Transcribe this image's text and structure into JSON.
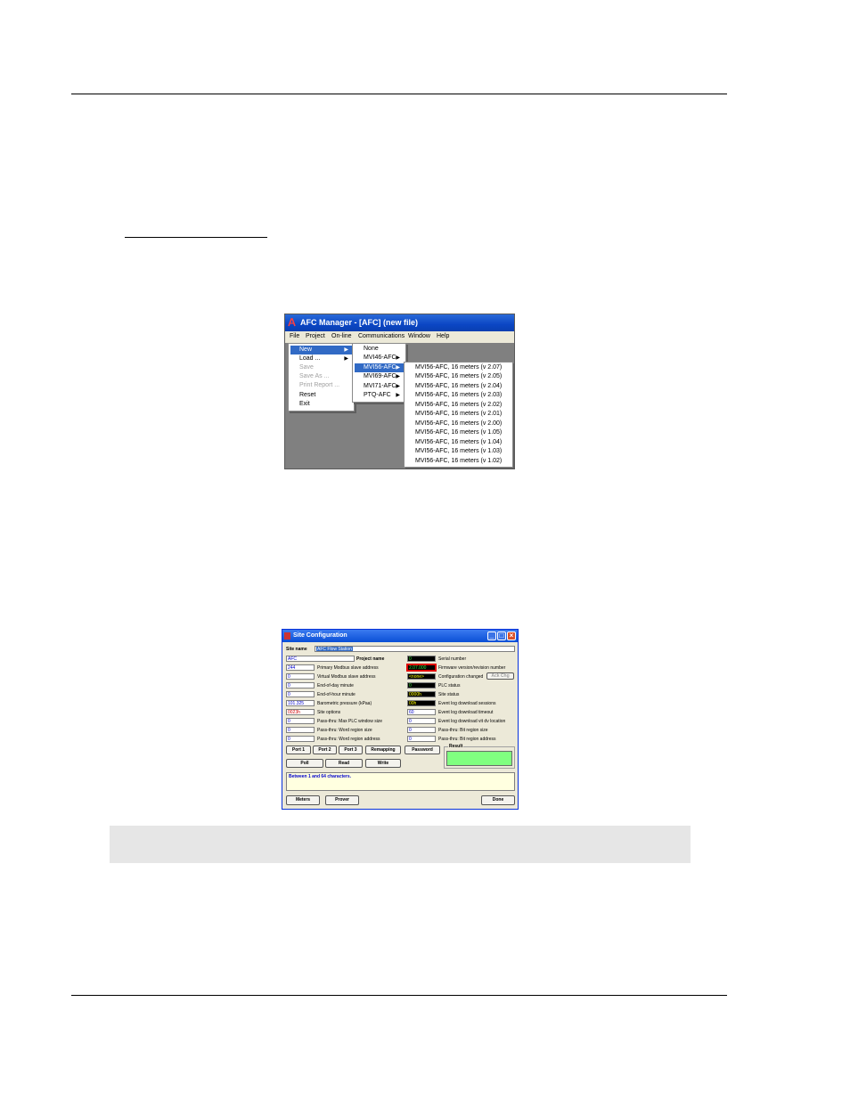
{
  "afc_manager": {
    "title": "AFC Manager  - [AFC] (new file)",
    "menu": [
      "File",
      "Project",
      "On-line",
      "Communications",
      "Window",
      "Help"
    ],
    "file_menu": [
      {
        "label": "New",
        "state": "selected",
        "submenu": true
      },
      {
        "label": "Load ...",
        "state": "normal",
        "submenu": true
      },
      {
        "label": "Save",
        "state": "disabled"
      },
      {
        "label": "Save As ...",
        "state": "disabled"
      },
      {
        "label": "Print Report ...",
        "state": "disabled"
      },
      {
        "label": "Reset",
        "state": "normal"
      },
      {
        "label": "Exit",
        "state": "normal"
      }
    ],
    "new_menu": [
      {
        "label": "None",
        "state": "normal",
        "submenu": false
      },
      {
        "label": "MVI46-AFC",
        "state": "normal",
        "submenu": true
      },
      {
        "label": "MVI56-AFC",
        "state": "selected",
        "submenu": true
      },
      {
        "label": "MVI69-AFC",
        "state": "normal",
        "submenu": true
      },
      {
        "label": "MVI71-AFC",
        "state": "normal",
        "submenu": true
      },
      {
        "label": "PTQ-AFC",
        "state": "normal",
        "submenu": true
      }
    ],
    "mvi56_menu": [
      "MVI56-AFC, 16 meters (v 2.07)",
      "MVI56-AFC, 16 meters (v 2.05)",
      "MVI56-AFC, 16 meters (v 2.04)",
      "MVI56-AFC, 16 meters (v 2.03)",
      "MVI56-AFC, 16 meters (v 2.02)",
      "MVI56-AFC, 16 meters (v 2.01)",
      "MVI56-AFC, 16 meters (v 2.00)",
      "MVI56-AFC, 16 meters (v 1.05)",
      "MVI56-AFC, 16 meters (v 1.04)",
      "MVI56-AFC, 16 meters (v 1.03)",
      "MVI56-AFC, 16 meters (v 1.02)"
    ]
  },
  "site_config": {
    "title": "Site Configuration",
    "site_name_label": "Site name",
    "site_name_value": "AFC Flow Station",
    "project_name_label": "Project name",
    "left_rows": [
      {
        "value": "AFC",
        "label": ""
      },
      {
        "value": "244",
        "label": "Primary Modbus slave address"
      },
      {
        "value": "0",
        "label": "Virtual Modbus slave address"
      },
      {
        "value": "0",
        "label": "End-of-day minute"
      },
      {
        "value": "0",
        "label": "End-of-hour minute"
      },
      {
        "value": "101.325",
        "label": "Barometric pressure (kPaa)"
      },
      {
        "value": "0023h",
        "label": "Site options"
      },
      {
        "value": "0",
        "label": "Pass-thru: Max PLC window size"
      },
      {
        "value": "0",
        "label": "Pass-thru: Word region size"
      },
      {
        "value": "0",
        "label": "Pass-thru: Word region address"
      }
    ],
    "right_rows": [
      {
        "value": "0",
        "label": "Serial number"
      },
      {
        "value": "2.07.000",
        "label": "Firmware version/revision number"
      },
      {
        "value": "<none>",
        "label": "Configuration changed"
      },
      {
        "value": "0",
        "label": "PLC status"
      },
      {
        "value": "0000h",
        "label": "Site status"
      },
      {
        "value": "00h",
        "label": "Event log download sessions"
      },
      {
        "value": "60",
        "label": "Event log download timeout"
      },
      {
        "value": "0",
        "label": "Event log download vit dv location"
      },
      {
        "value": "0",
        "label": "Pass-thru: Bit region size"
      },
      {
        "value": "0",
        "label": "Pass-thru: Bit region address"
      }
    ],
    "ack_chg": "Ack Chg",
    "buttons_row1": [
      "Port 1",
      "Port 2",
      "Port 3",
      "Remapping",
      "Password"
    ],
    "buttons_row2": [
      "Poll",
      "Read",
      "Write"
    ],
    "result_label": "Result",
    "status_text": "Between 1 and 64 characters.",
    "bottom_buttons": {
      "meters": "Meters",
      "prover": "Prover",
      "done": "Done"
    }
  }
}
